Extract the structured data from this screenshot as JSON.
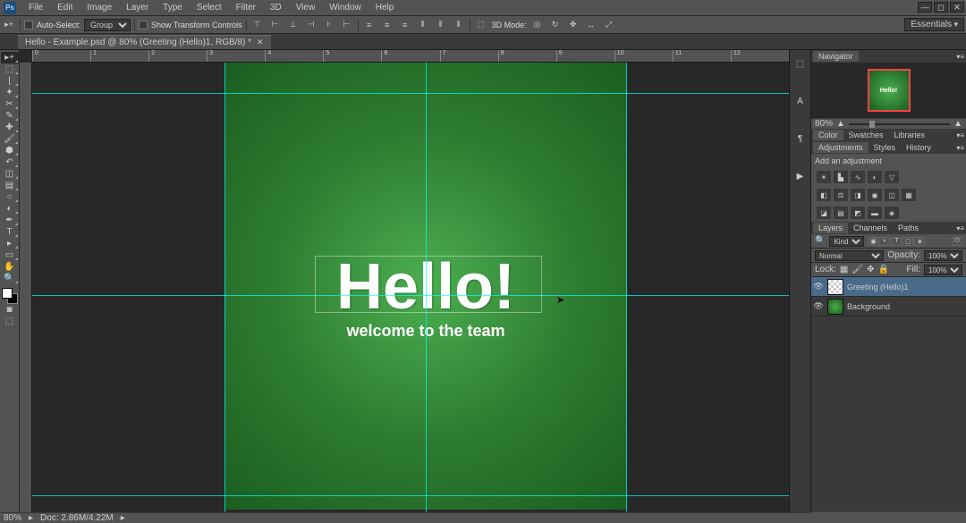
{
  "menubar": {
    "items": [
      "File",
      "Edit",
      "Image",
      "Layer",
      "Type",
      "Select",
      "Filter",
      "3D",
      "View",
      "Window",
      "Help"
    ]
  },
  "workspace": "Essentials",
  "options": {
    "auto_select": "Auto-Select:",
    "group": "Group",
    "show_transform": "Show Transform Controls",
    "mode_3d": "3D Mode:"
  },
  "document": {
    "tab_title": "Hello - Example.psd @ 80% (Greeting (Hello)1, RGB/8) *",
    "hello": "Hello!",
    "welcome": "welcome to the team"
  },
  "ruler_marks": [
    "0",
    "1",
    "2",
    "3",
    "4",
    "5",
    "6",
    "7",
    "8",
    "9",
    "10",
    "11",
    "12"
  ],
  "navigator": {
    "tab": "Navigator",
    "zoom": "80%",
    "thumb_text": "Hello!"
  },
  "color_panel": {
    "tabs": [
      "Color",
      "Swatches",
      "Libraries"
    ]
  },
  "adjustments_panel": {
    "tabs": [
      "Adjustments",
      "Styles",
      "History"
    ],
    "add_label": "Add an adjustment"
  },
  "layers_panel": {
    "tabs": [
      "Layers",
      "Channels",
      "Paths"
    ],
    "kind": "Kind",
    "blend_mode": "Normal",
    "opacity_label": "Opacity:",
    "opacity_value": "100%",
    "lock_label": "Lock:",
    "fill_label": "Fill:",
    "fill_value": "100%",
    "layers": [
      {
        "name": "Greeting (Hello)1",
        "visible": true,
        "selected": true,
        "thumb": "transparent"
      },
      {
        "name": "Background",
        "visible": true,
        "selected": false,
        "thumb": "green"
      }
    ]
  },
  "status": {
    "zoom": "80%",
    "doc_info": "Doc: 2.86M/4.22M"
  }
}
